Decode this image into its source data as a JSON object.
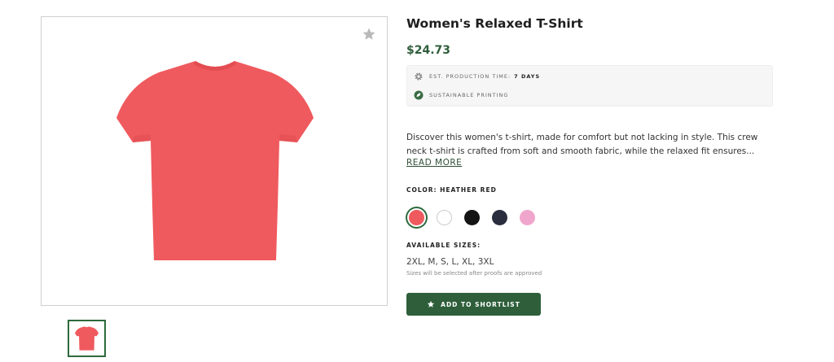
{
  "product": {
    "title": "Women's Relaxed T-Shirt",
    "price": "$24.73"
  },
  "info": {
    "production_label": "EST. PRODUCTION TIME:",
    "production_value": "7 DAYS",
    "production_icon": "gear-icon",
    "sustainable_label": "SUSTAINABLE PRINTING",
    "sustainable_icon": "leaf-icon"
  },
  "description": {
    "text": "Discover this women's t-shirt, made for comfort but not lacking in style. This crew neck t-shirt is crafted from soft and smooth fabric, while the relaxed fit ensures...",
    "read_more": "READ MORE"
  },
  "color": {
    "label": "COLOR: HEATHER RED",
    "swatches": [
      {
        "name": "Heather Red",
        "hex": "#ef5a5e",
        "selected": true
      },
      {
        "name": "White",
        "hex": "#ffffff",
        "selected": false
      },
      {
        "name": "Black",
        "hex": "#141414",
        "selected": false
      },
      {
        "name": "Navy",
        "hex": "#2a2d3d",
        "selected": false
      },
      {
        "name": "Pink",
        "hex": "#f0a6cc",
        "selected": false
      }
    ]
  },
  "sizes": {
    "label": "AVAILABLE SIZES:",
    "list": "2XL, M, S, L, XL, 3XL",
    "note": "Sizes will be selected after proofs are approved"
  },
  "cta": {
    "label": "ADD TO SHORTLIST",
    "icon": "star-icon"
  },
  "colors": {
    "accent_green": "#2e5f3a",
    "shirt_red": "#ef5a5e"
  }
}
